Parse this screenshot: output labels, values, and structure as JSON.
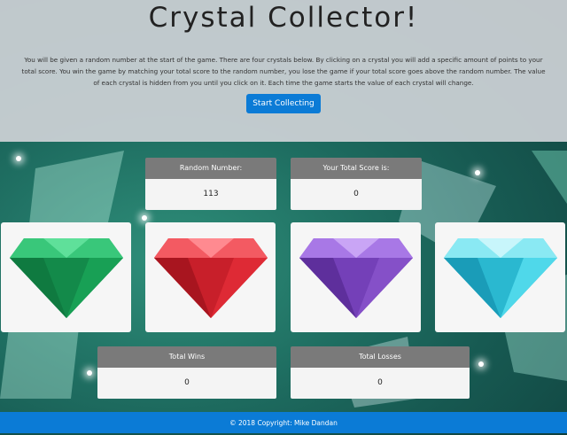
{
  "header": {
    "title": "Crystal Collector!",
    "instructions": "You will be given a random number at the start of the game. There are four crystals below. By clicking on a crystal you will add a specific amount of points to your total score. You win the game by matching your total score to the random number, you lose the game if your total score goes above the random number. The value of each crystal is hidden from you until you click on it. Each time the game starts the value of each crystal will change.",
    "start_button": "Start Collecting"
  },
  "scoreboard": {
    "random_number_label": "Random Number:",
    "random_number_value": "113",
    "total_score_label": "Your Total Score is:",
    "total_score_value": "0"
  },
  "crystals": [
    {
      "name": "green-crystal",
      "color": "#1aa85c"
    },
    {
      "name": "red-crystal",
      "color": "#e8303a"
    },
    {
      "name": "purple-crystal",
      "color": "#8a4fd0"
    },
    {
      "name": "cyan-crystal",
      "color": "#3fd3e6"
    }
  ],
  "stats": {
    "wins_label": "Total Wins",
    "wins_value": "0",
    "losses_label": "Total Losses",
    "losses_value": "0"
  },
  "footer": {
    "text": "© 2018 Copyright: Mike Dandan"
  },
  "colors": {
    "accent_blue": "#0b7bd6",
    "panel_header_gray": "#7a7a7a"
  }
}
